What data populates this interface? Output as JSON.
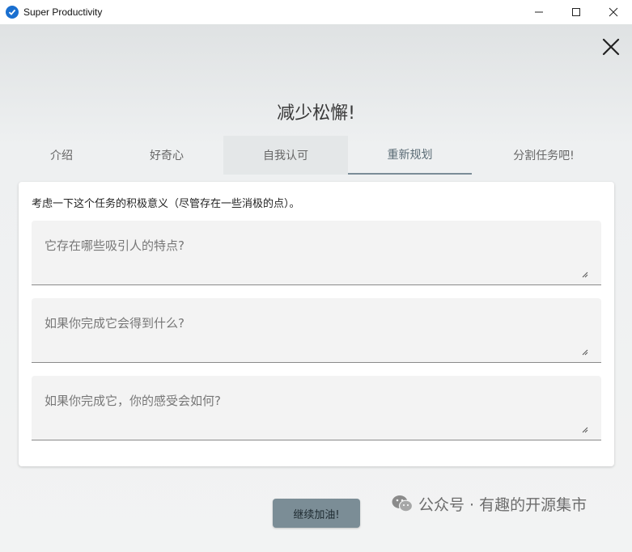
{
  "window": {
    "title": "Super Productivity",
    "minimize_icon": "minimize-icon",
    "maximize_icon": "maximize-icon",
    "close_icon": "close-icon"
  },
  "dialog": {
    "heading": "减少松懈!",
    "close_icon": "close-icon",
    "tabs": [
      {
        "label": "介绍",
        "state": "normal"
      },
      {
        "label": "好奇心",
        "state": "normal"
      },
      {
        "label": "自我认可",
        "state": "hover"
      },
      {
        "label": "重新规划",
        "state": "active"
      },
      {
        "label": "分割任务吧!",
        "state": "normal"
      }
    ],
    "instruction": "考虑一下这个任务的积极意义（尽管存在一些消极的点）。",
    "fields": [
      {
        "placeholder": "它存在哪些吸引人的特点?",
        "value": ""
      },
      {
        "placeholder": "如果你完成它会得到什么?",
        "value": ""
      },
      {
        "placeholder": "如果你完成它，你的感受会如何?",
        "value": ""
      }
    ],
    "continue_label": "继续加油!"
  },
  "watermark": {
    "text": "公众号 · 有趣的开源集市",
    "icon": "wechat-icon"
  },
  "colors": {
    "accent": "#7b8d96",
    "active_tab_underline": "#7a8d97"
  }
}
